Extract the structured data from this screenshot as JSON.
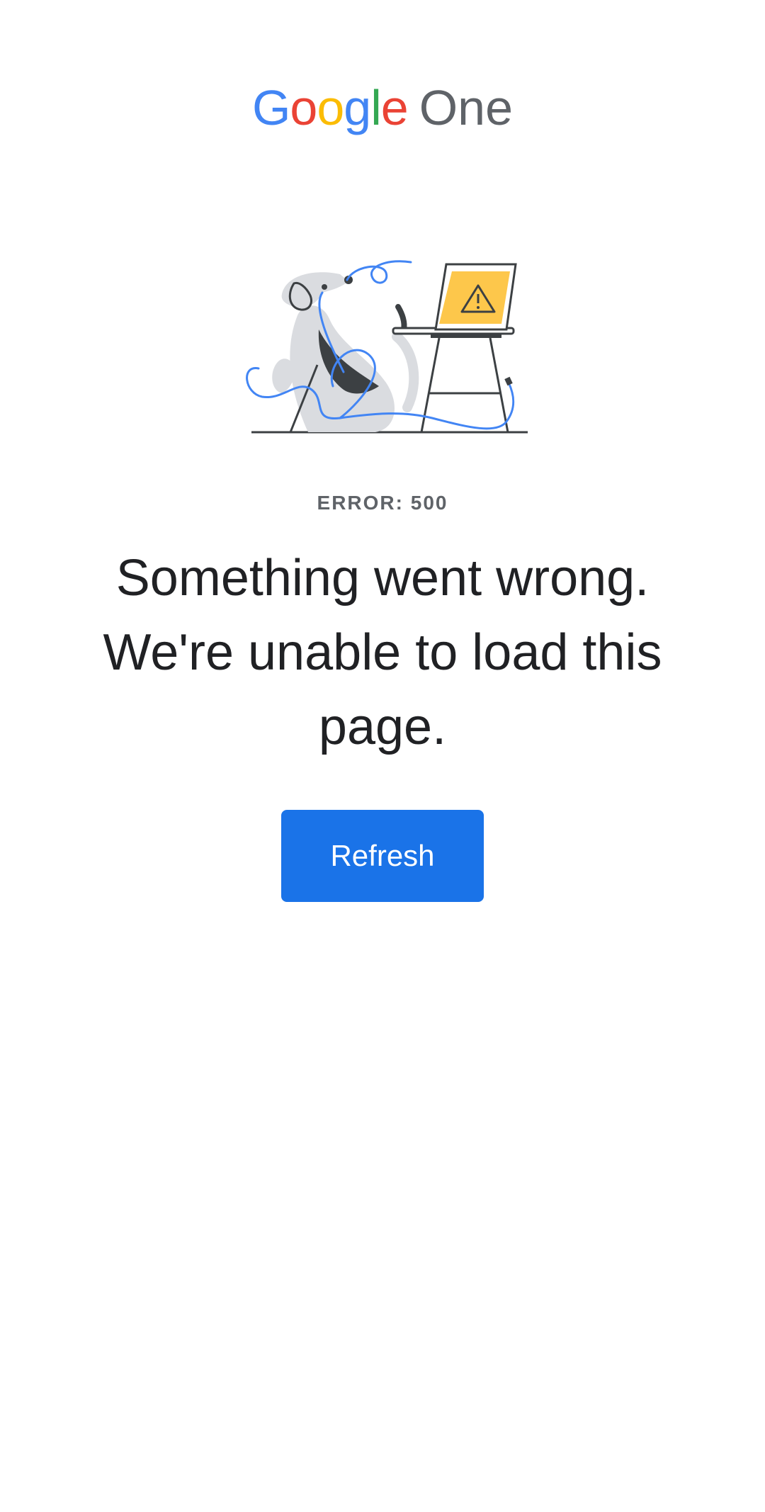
{
  "logo": {
    "letters": [
      "G",
      "o",
      "o",
      "g",
      "l",
      "e"
    ],
    "product": "One",
    "colors": {
      "blue": "#4285F4",
      "red": "#EA4335",
      "yellow": "#FBBC05",
      "green": "#34A853",
      "product_gray": "#5f6368"
    }
  },
  "illustration": {
    "icon": "dog-with-broken-laptop-illustration",
    "warning_icon": "warning-triangle-icon"
  },
  "error": {
    "code_label": "ERROR: 500"
  },
  "message": {
    "headline": "Something went wrong. We're unable to load this page."
  },
  "actions": {
    "refresh_label": "Refresh",
    "button_color": "#1a73e8"
  }
}
